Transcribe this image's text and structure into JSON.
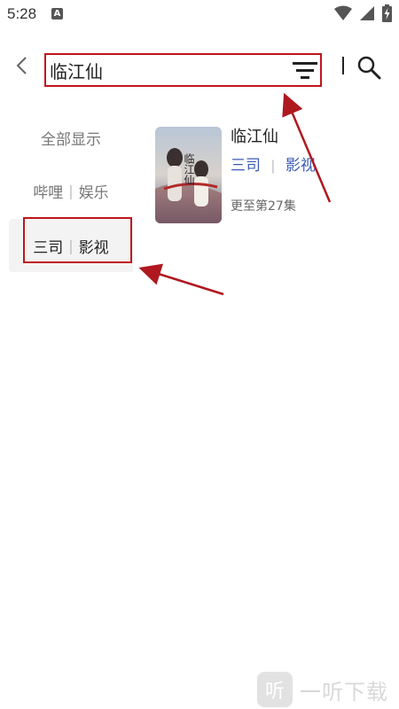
{
  "status_bar": {
    "time": "5:28",
    "notification_icon_label": "A",
    "icons": [
      "wifi-icon",
      "signal-icon",
      "battery-charging-icon"
    ]
  },
  "header": {
    "search_value": "临江仙",
    "icons": [
      "back-icon",
      "filter-icon",
      "search-icon"
    ]
  },
  "categories": [
    {
      "label": "全部显示"
    },
    {
      "name": "哔哩",
      "type": "娱乐"
    },
    {
      "name": "三司",
      "type": "影视",
      "selected": true
    }
  ],
  "result": {
    "title": "临江仙",
    "source_name": "三司",
    "source_type": "影视",
    "update_text": "更至第27集",
    "poster_title": "临江仙"
  },
  "colors": {
    "annotation_red": "#c0151d",
    "source_blue": "#3b5bb5",
    "selected_bg": "#f3f3f3"
  },
  "watermark": {
    "logo_char": "听",
    "text": "一听下载"
  }
}
